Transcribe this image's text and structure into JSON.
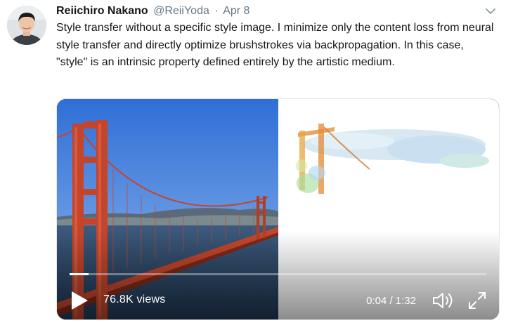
{
  "tweet": {
    "author_name": "Reiichiro Nakano",
    "handle": "@ReiiYoda",
    "separator": "·",
    "date": "Apr 8",
    "text": "Style transfer without a specific style image. I minimize only the content loss from neural style transfer and directly optimize brushstrokes via backpropagation. In this case, \"style\" is an intrinsic property defined entirely by the artistic medium."
  },
  "media": {
    "views": "76.8K views",
    "time": "0:04 / 1:32",
    "progress_fraction": 0.045
  },
  "icons": {
    "caret": "chevron-down-icon",
    "play": "play-icon",
    "volume": "volume-icon",
    "fullscreen": "fullscreen-icon"
  },
  "colors": {
    "text": "#14171a",
    "secondary": "#657786",
    "bridge": "#c4452b"
  }
}
